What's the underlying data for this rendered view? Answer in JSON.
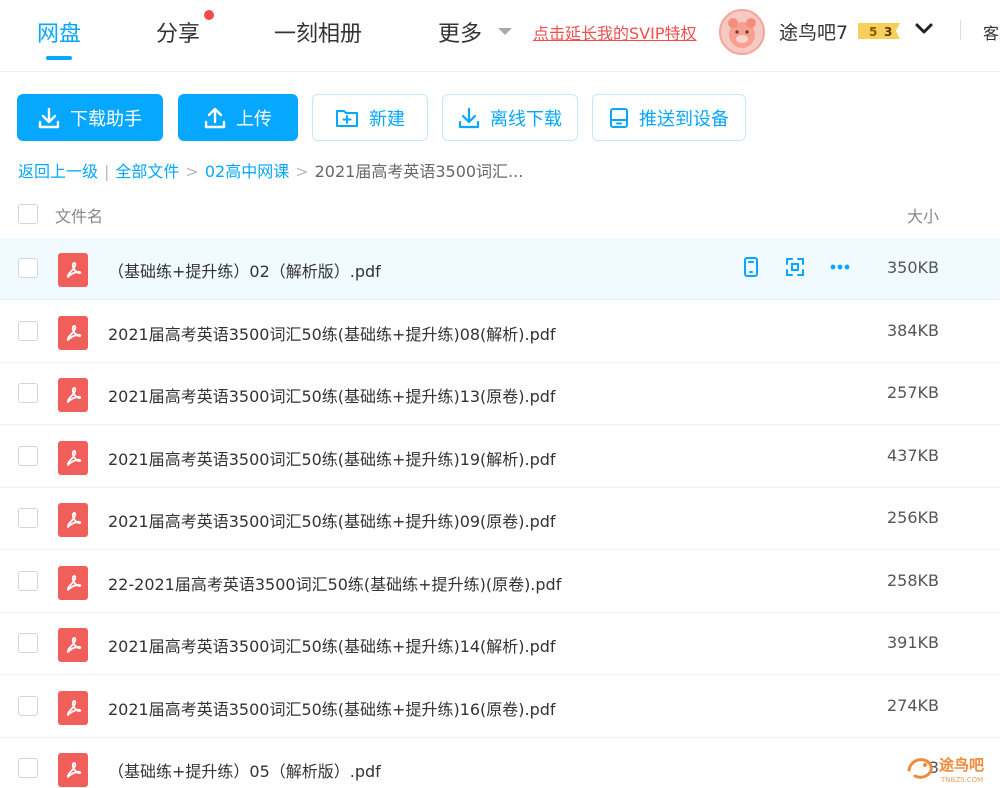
{
  "nav": {
    "tabs": [
      {
        "label": "网盘",
        "active": true
      },
      {
        "label": "分享",
        "active": false
      },
      {
        "label": "一刻相册",
        "active": false
      },
      {
        "label": "更多",
        "active": false
      }
    ],
    "svip_link": "点击延长我的SVIP特权",
    "username": "途鸟吧7",
    "vip_level_a": "5",
    "vip_level_b": "3",
    "client_label": "客",
    "colors": {
      "accent": "#06a7ff",
      "alert": "#f34d4d"
    }
  },
  "toolbar": {
    "download_helper": "下载助手",
    "upload": "上传",
    "new_folder": "新建",
    "offline_download": "离线下载",
    "push_device": "推送到设备"
  },
  "breadcrumb": {
    "back": "返回上一级",
    "all_files": "全部文件",
    "folder": "02高中网课",
    "current": "2021届高考英语3500词汇..."
  },
  "table": {
    "col_name": "文件名",
    "col_size": "大小",
    "rows": [
      {
        "name": "（基础练+提升练）02（解析版）.pdf",
        "size": "350KB"
      },
      {
        "name": "2021届高考英语3500词汇50练(基础练+提升练)08(解析).pdf",
        "size": "384KB"
      },
      {
        "name": "2021届高考英语3500词汇50练(基础练+提升练)13(原卷).pdf",
        "size": "257KB"
      },
      {
        "name": "2021届高考英语3500词汇50练(基础练+提升练)19(解析).pdf",
        "size": "437KB"
      },
      {
        "name": "2021届高考英语3500词汇50练(基础练+提升练)09(原卷).pdf",
        "size": "256KB"
      },
      {
        "name": "22-2021届高考英语3500词汇50练(基础练+提升练)(原卷).pdf",
        "size": "258KB"
      },
      {
        "name": "2021届高考英语3500词汇50练(基础练+提升练)14(解析).pdf",
        "size": "391KB"
      },
      {
        "name": "2021届高考英语3500词汇50练(基础练+提升练)16(原卷).pdf",
        "size": "274KB"
      },
      {
        "name": "（基础练+提升练）05（解析版）.pdf",
        "size": "3"
      }
    ]
  },
  "watermark": {
    "text": "途鸟吧",
    "sub": "TNBZS.COM"
  }
}
